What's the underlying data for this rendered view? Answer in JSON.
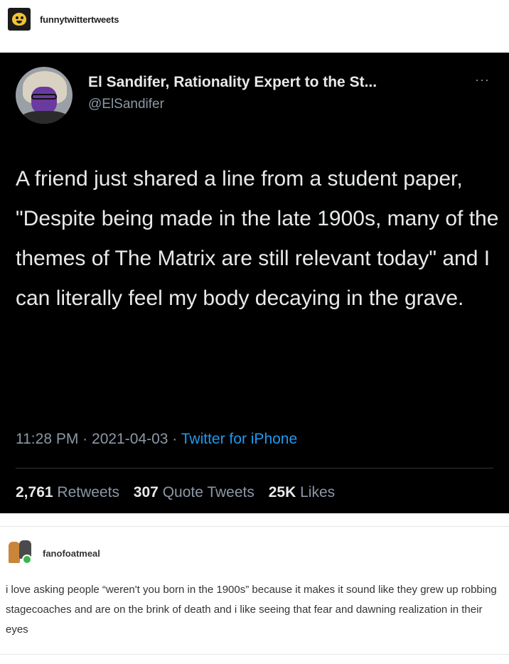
{
  "post": {
    "reblogger": "funnytwittertweets",
    "reblogger_avatar_icon": "bear-face-icon"
  },
  "tweet": {
    "author_name": "El Sandifer, Rationality Expert to the St...",
    "author_handle": "@ElSandifer",
    "more_icon": "ellipsis-icon",
    "text": "A friend just shared a line from a student paper, \"Despite being made in the late 1900s, many of the themes of The Matrix are still relevant today\" and I can literally feel my body decaying in the grave.",
    "time": "11:28 PM",
    "date": "2021-04-03",
    "separator": "·",
    "source": "Twitter for iPhone",
    "retweets_count": "2,761",
    "retweets_label": "Retweets",
    "quotes_count": "307",
    "quotes_label": "Quote Tweets",
    "likes_count": "25K",
    "likes_label": "Likes"
  },
  "reply": {
    "username": "fanofoatmeal",
    "text": "i love asking people “weren't you born in the 1900s” because it makes it sound like they grew up robbing stagecoaches and are on the brink of death and i like seeing that fear and dawning realization in their eyes"
  },
  "colors": {
    "tweet_bg": "#000000",
    "tweet_text": "#e7e9ea",
    "tweet_muted": "#8b98a5",
    "link_blue": "#1d9bf0"
  }
}
